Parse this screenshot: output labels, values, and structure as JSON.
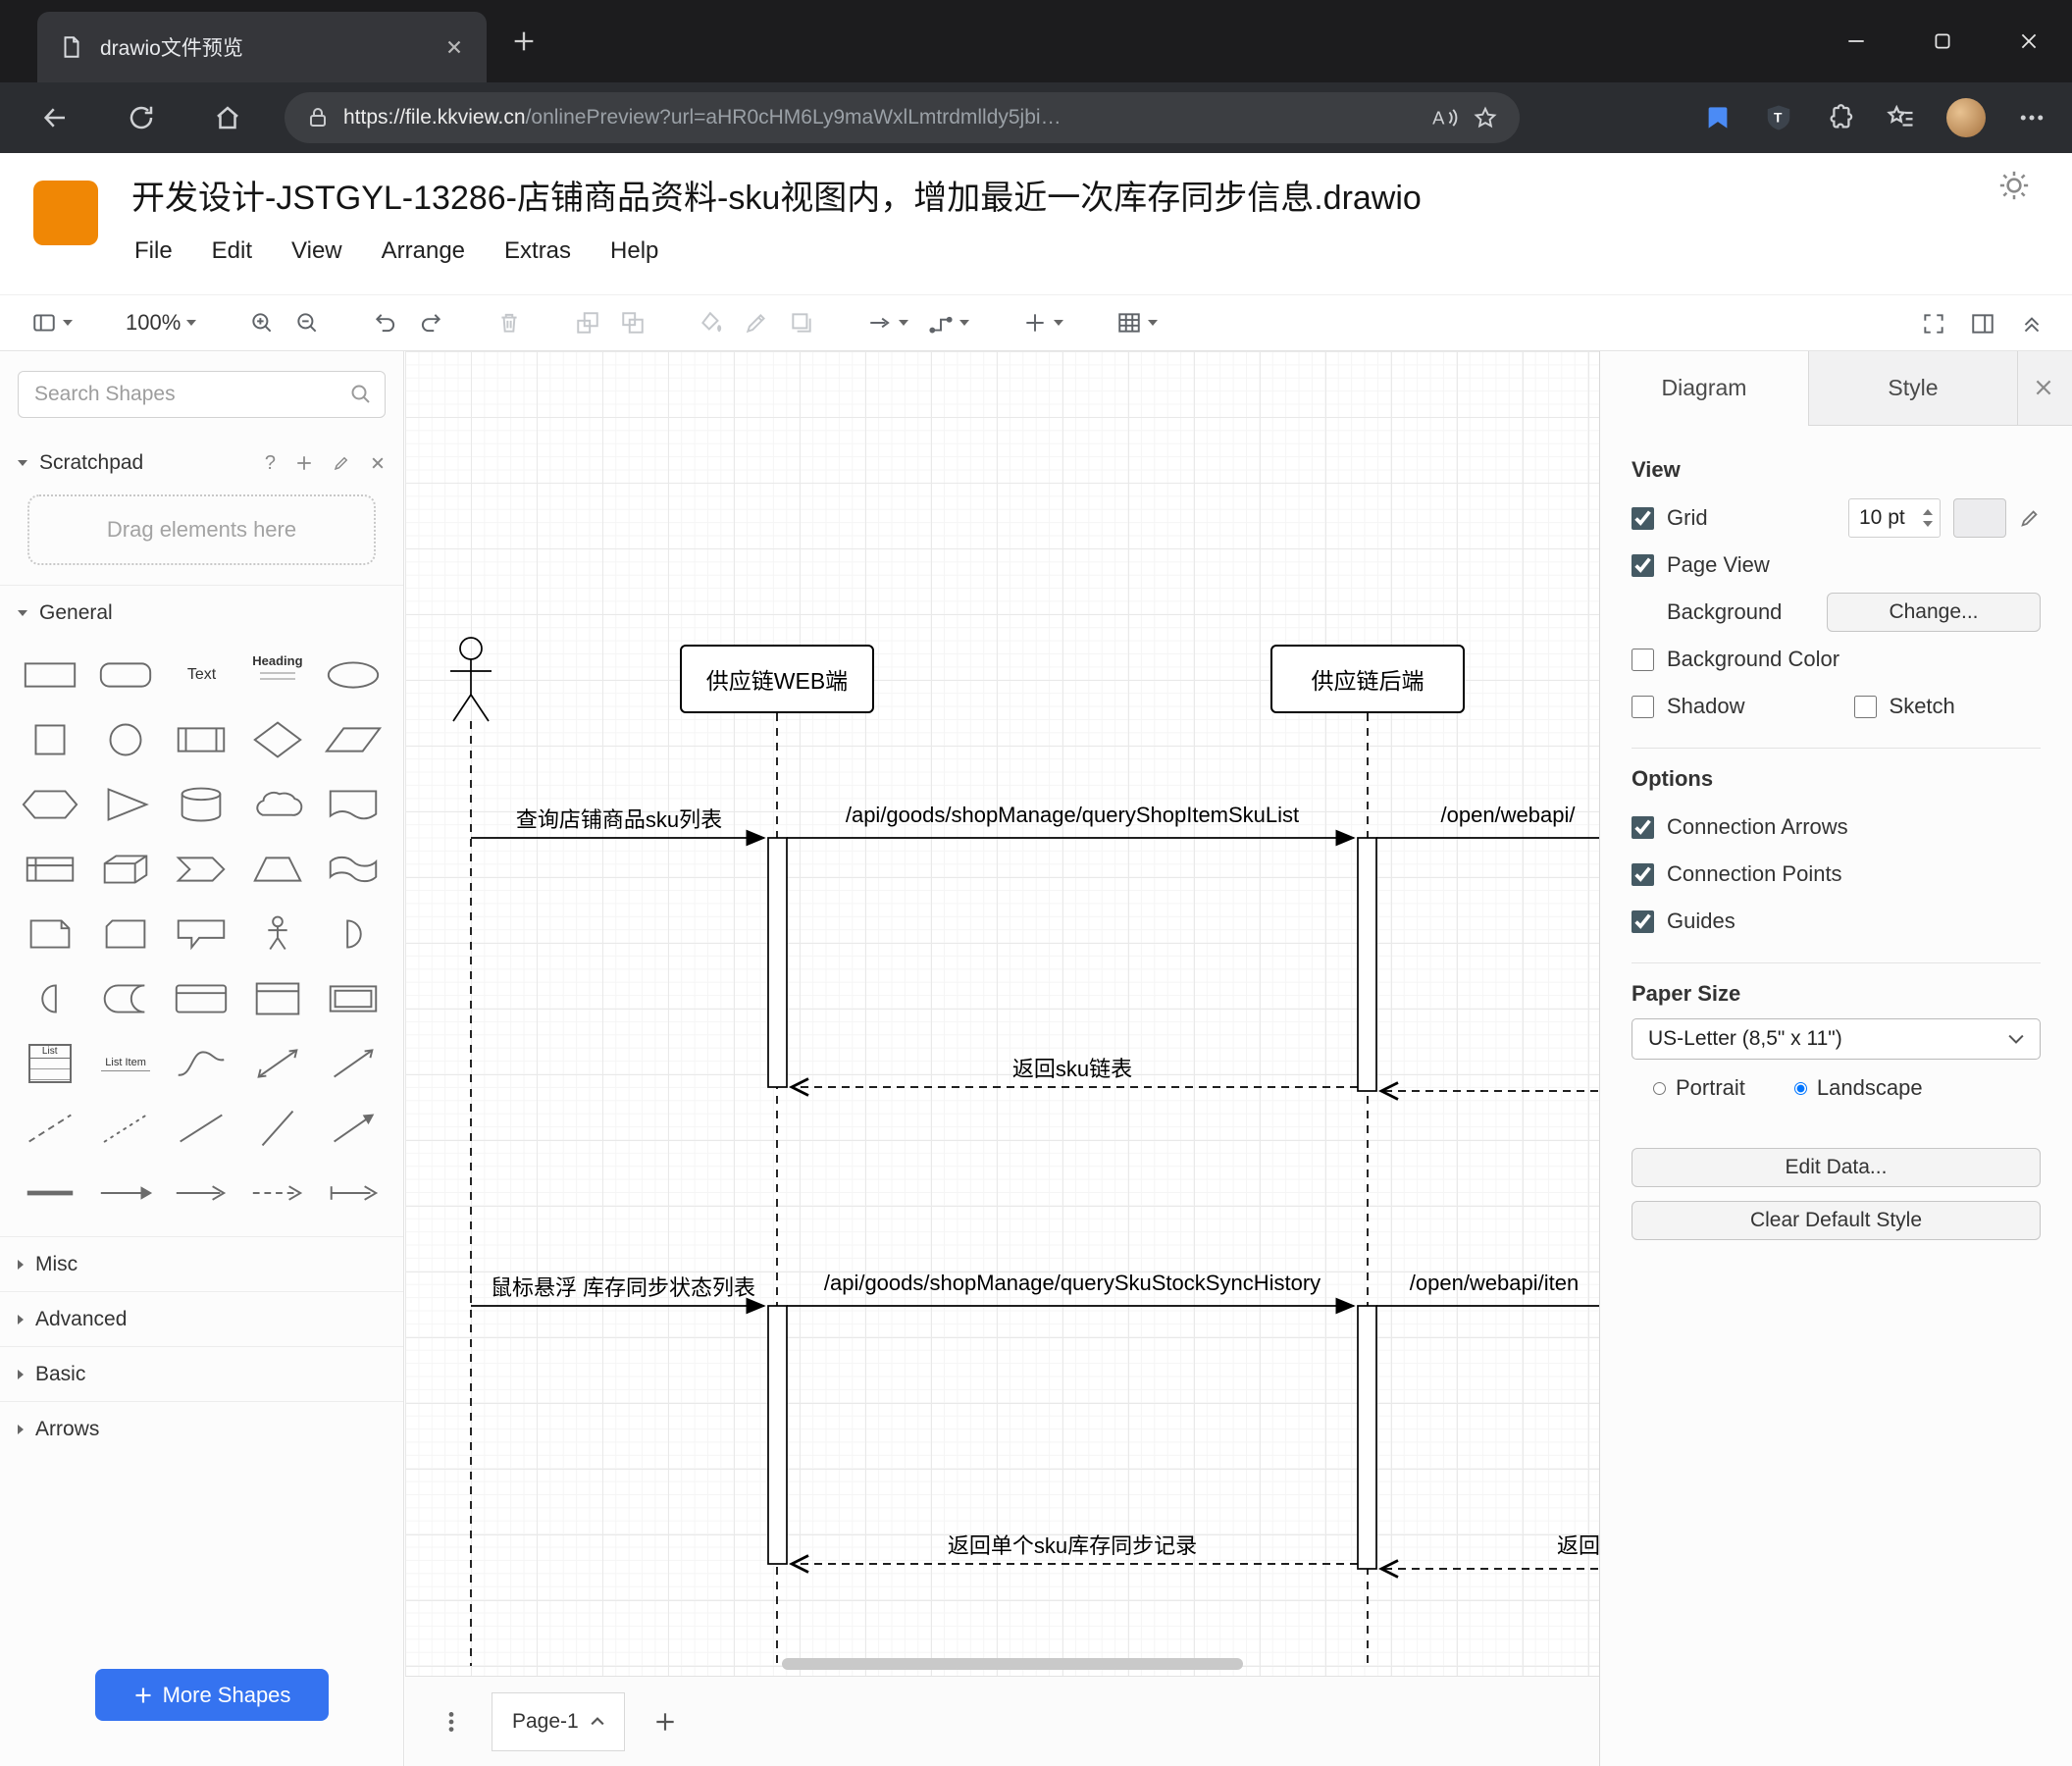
{
  "browser": {
    "tab_title": "drawio文件预览",
    "url_host": "https://file.kkview.cn",
    "url_path": "/onlinePreview?url=aHR0cHM6Ly9maWxlLmtrdmlldy5jbi…"
  },
  "header": {
    "title": "开发设计-JSTGYL-13286-店铺商品资料-sku视图内，增加最近一次库存同步信息.drawio",
    "menu": {
      "file": "File",
      "edit": "Edit",
      "view": "View",
      "arrange": "Arrange",
      "extras": "Extras",
      "help": "Help"
    }
  },
  "toolbar": {
    "zoom": "100%"
  },
  "sidebar": {
    "search_placeholder": "Search Shapes",
    "scratchpad_title": "Scratchpad",
    "scratchpad_help": "?",
    "drag_hint": "Drag elements here",
    "sections": {
      "general": "General",
      "misc": "Misc",
      "advanced": "Advanced",
      "basic": "Basic",
      "arrows": "Arrows"
    },
    "labels": {
      "text": "Text",
      "heading": "Heading",
      "list": "List",
      "list_item": "List Item"
    },
    "more_shapes": "More Shapes"
  },
  "diagram": {
    "lifelines": {
      "web": "供应链WEB端",
      "backend": "供应链后端"
    },
    "messages": {
      "m1": "查询店铺商品sku列表",
      "m2": "/api/goods/shopManage/queryShopItemSkuList",
      "m3": "/open/webapi/",
      "r1": "返回sku链表",
      "m4": "鼠标悬浮 库存同步状态列表",
      "m5": "/api/goods/shopManage/querySkuStockSyncHistory",
      "m6": "/open/webapi/iten",
      "r2": "返回单个sku库存同步记录",
      "r3": "返回"
    }
  },
  "format_panel": {
    "tab_diagram": "Diagram",
    "tab_style": "Style",
    "view": {
      "heading": "View",
      "grid": "Grid",
      "grid_size": "10 pt",
      "page_view": "Page View",
      "background": "Background",
      "change_button": "Change...",
      "background_color": "Background Color",
      "shadow": "Shadow",
      "sketch": "Sketch"
    },
    "options": {
      "heading": "Options",
      "connection_arrows": "Connection Arrows",
      "connection_points": "Connection Points",
      "guides": "Guides"
    },
    "paper": {
      "heading": "Paper Size",
      "size_value": "US-Letter (8,5\" x 11\")",
      "portrait": "Portrait",
      "landscape": "Landscape"
    },
    "buttons": {
      "edit_data": "Edit Data...",
      "clear_default_style": "Clear Default Style"
    },
    "state": {
      "grid": true,
      "page_view": true,
      "background_color": false,
      "shadow": false,
      "sketch": false,
      "connection_arrows": true,
      "connection_points": true,
      "guides": true,
      "portrait": false,
      "landscape": true
    }
  },
  "footer": {
    "page_tab": "Page-1"
  },
  "colors": {
    "logo_orange": "#f08705",
    "accent_blue": "#3573f0",
    "checkbox_accent": "#455a64"
  }
}
